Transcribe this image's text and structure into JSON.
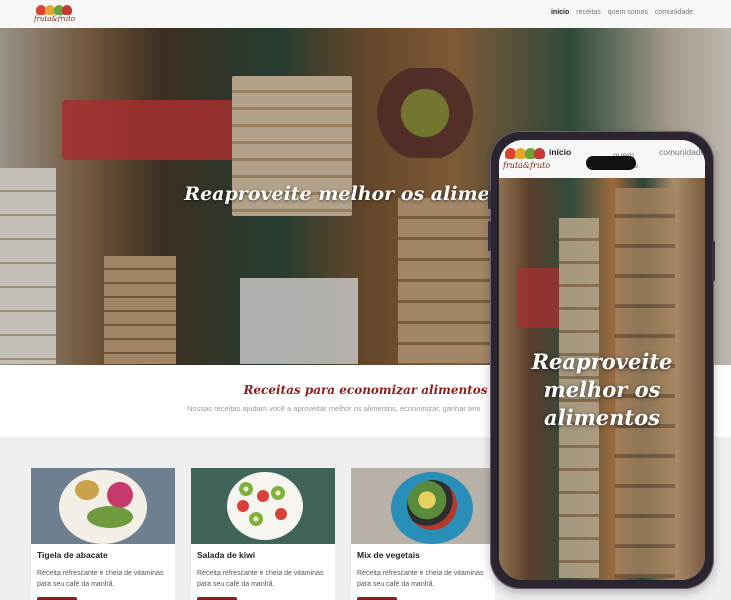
{
  "brand": {
    "logo_text": "fruta&fruto"
  },
  "nav": {
    "items": [
      {
        "label": "início",
        "active": true
      },
      {
        "label": "receitas",
        "active": false
      },
      {
        "label": "quem somos",
        "active": false
      },
      {
        "label": "comunidade",
        "active": false
      }
    ]
  },
  "hero": {
    "title": "Reaproveite melhor os alimentos"
  },
  "intro": {
    "heading": "Receitas para economizar alimentos",
    "text": "Nossas receitas ajudam você a aproveitar melhor os alimentos, economizar, ganhar tem"
  },
  "cards": [
    {
      "title": "Tigela de abacate",
      "description": "Receita refrescante e cheia de vitaminas para seu café da manhã."
    },
    {
      "title": "Salada de kiwi",
      "description": "Receita refrescante e cheia de vitaminas para seu café da manhã."
    },
    {
      "title": "Mix de vegetais",
      "description": "Receita refrescante e cheia de vitaminas para seu café da manhã."
    }
  ],
  "colors": {
    "accent": "#8c1c1c",
    "nav_bg": "#f7f7f7",
    "cards_bg": "#efefef",
    "logo_text": "#7a2a12"
  }
}
